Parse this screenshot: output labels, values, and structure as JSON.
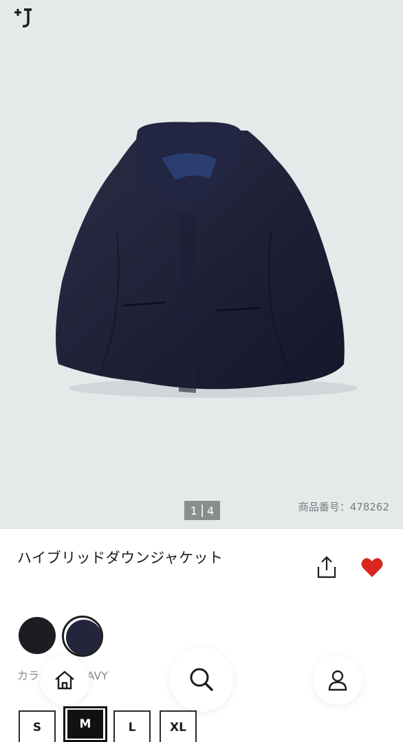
{
  "brand": {
    "logo_text": "+J"
  },
  "gallery": {
    "pager_current": "1",
    "pager_separator": "|",
    "pager_total": "4",
    "sku": "商品番号：478262"
  },
  "product": {
    "title": "ハイブリッドダウンジャケット",
    "color_label": "カラー：69 NAVY"
  },
  "colors": {
    "swatch_1": "#1c1d22",
    "swatch_2": "#23253a",
    "favorite": "#d9251d"
  },
  "sizes": [
    "S",
    "M",
    "L",
    "XL"
  ],
  "nav": {
    "icons": [
      "home-icon",
      "search-icon",
      "account-icon"
    ]
  }
}
